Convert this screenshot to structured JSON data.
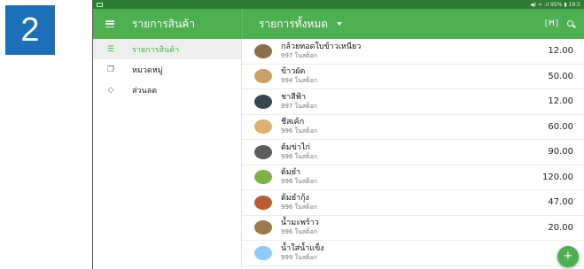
{
  "step_number": "2",
  "status_bar": {
    "text": "◀) ≈ .ıl 95% ▮ 19:5"
  },
  "sidebar": {
    "title": "รายการสินค้า",
    "items": [
      {
        "label": "รายการสินค้า",
        "icon": "list-icon",
        "active": true
      },
      {
        "label": "หมวดหมู่",
        "icon": "category-icon",
        "active": false
      },
      {
        "label": "ส่วนลด",
        "icon": "tag-icon",
        "active": false
      }
    ]
  },
  "main": {
    "title": "รายการทั้งหมด",
    "scan_glyph": "[Ħ]",
    "products": [
      {
        "name": "กล้วยทอดใบข้าวเหนียว",
        "stock": "997 ในสต็อก",
        "price": "12.00",
        "thumb_color": "#8d6e4a"
      },
      {
        "name": "ข้าวผัด",
        "stock": "994 ในสต็อก",
        "price": "50.00",
        "thumb_color": "#c8a165"
      },
      {
        "name": "ชาสีฟ้า",
        "stock": "997 ในสต็อก",
        "price": "12.00",
        "thumb_color": "#37474f"
      },
      {
        "name": "ชีสเค้ก",
        "stock": "996 ในสต็อก",
        "price": "60.00",
        "thumb_color": "#e0b070"
      },
      {
        "name": "ต้มข่าไก่",
        "stock": "996 ในสต็อก",
        "price": "90.00",
        "thumb_color": "#5d5d5d"
      },
      {
        "name": "ต้มยำ",
        "stock": "996 ในสต็อก",
        "price": "120.00",
        "thumb_color": "#7cb342"
      },
      {
        "name": "ต้มยำกุ้ง",
        "stock": "996 ในสต็อก",
        "price": "47.00",
        "thumb_color": "#b85c38"
      },
      {
        "name": "น้ำมะพร้าว",
        "stock": "996 ในสต็อก",
        "price": "20.00",
        "thumb_color": "#9c7a4d"
      },
      {
        "name": "น้ำใส่น้ำแข็ง",
        "stock": "999 ในสต็อก",
        "price": "",
        "thumb_color": "#90caf9"
      }
    ],
    "fab_label": "+"
  }
}
